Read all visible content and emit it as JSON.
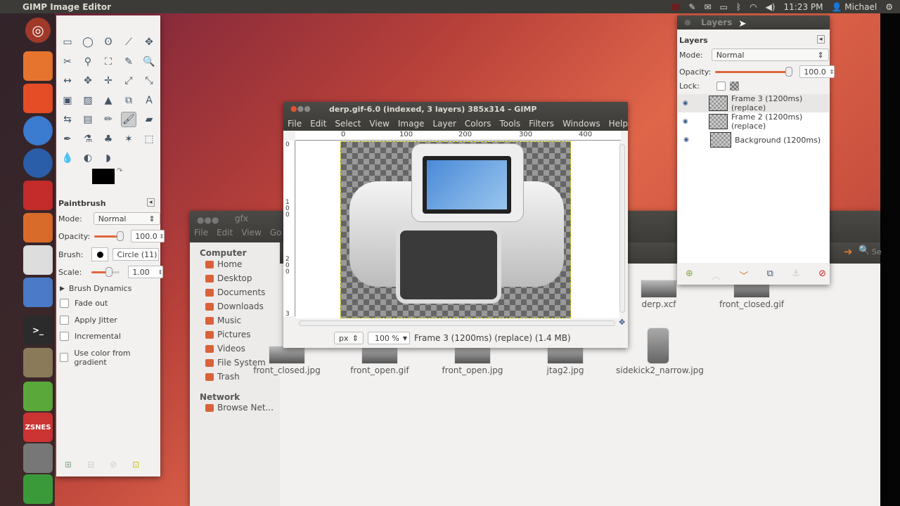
{
  "top_panel": {
    "app_title": "GIMP Image Editor",
    "time": "11:23 PM",
    "user": "Michael",
    "indicators": [
      "network-status-icon",
      "paperclip-icon",
      "mail-icon",
      "battery-icon",
      "bluetooth-icon",
      "wifi-icon",
      "volume-icon"
    ]
  },
  "launcher": {
    "items": [
      "ubuntu-dash",
      "files",
      "firefox-alt",
      "chromium",
      "thunderbird",
      "pdf-reader",
      "inkscape",
      "text-editor",
      "pidgin",
      "terminal",
      "gimp",
      "system-settings",
      "zsnes",
      "keyboard-app",
      "spreadsheet"
    ]
  },
  "toolbox": {
    "options_title": "Paintbrush",
    "mode_label": "Mode:",
    "mode_value": "Normal",
    "opacity_label": "Opacity:",
    "opacity_value": "100.0",
    "opacity_fraction": 1.0,
    "brush_label": "Brush:",
    "brush_value": "Circle (11)",
    "scale_label": "Scale:",
    "scale_value": "1.00",
    "brush_dynamics": "Brush Dynamics",
    "checkboxes": [
      {
        "label": "Fade out",
        "checked": false
      },
      {
        "label": "Apply Jitter",
        "checked": false
      },
      {
        "label": "Incremental",
        "checked": false
      },
      {
        "label": "Use color from gradient",
        "checked": false
      }
    ],
    "foreground": "#000000",
    "background": "#ffffff"
  },
  "image_window": {
    "title": "derp.gif-6.0 (indexed, 3 layers) 385x314 – GIMP",
    "menu": [
      "File",
      "Edit",
      "Select",
      "View",
      "Image",
      "Layer",
      "Colors",
      "Tools",
      "Filters",
      "Windows",
      "Help"
    ],
    "ruler_ticks": [
      "0",
      "100",
      "200",
      "300",
      "400"
    ],
    "vruler_ticks": [
      "0",
      "1 0 0",
      "2 0 0",
      "3"
    ],
    "unit": "px",
    "zoom": "100 %",
    "status": "Frame 3 (1200ms) (replace) (1.4 MB)"
  },
  "layers_window": {
    "window_title": "Layers",
    "panel_title": "Layers",
    "mode_label": "Mode:",
    "mode_value": "Normal",
    "opacity_label": "Opacity:",
    "opacity_value": "100.0",
    "lock_label": "Lock:",
    "layers": [
      {
        "name": "Frame 3 (1200ms) (replace)",
        "selected": true
      },
      {
        "name": "Frame 2 (1200ms) (replace)",
        "selected": false
      },
      {
        "name": "Background (1200ms)",
        "selected": false
      }
    ]
  },
  "file_manager": {
    "title": "gfx",
    "menu": [
      "File",
      "Edit",
      "View",
      "Go"
    ],
    "search_label": "Se",
    "computer_heading": "Computer",
    "places": [
      "Home",
      "Desktop",
      "Documents",
      "Downloads",
      "Music",
      "Pictures",
      "Videos",
      "File System",
      "Trash"
    ],
    "network_heading": "Network",
    "network_items": [
      "Browse Net..."
    ],
    "files": [
      "derp.xcf",
      "front_closed.gif",
      "front_closed.jpg",
      "front_open.gif",
      "front_open.jpg",
      "jtag2.jpg",
      "sidekick2_narrow.jpg"
    ]
  },
  "colors": {
    "accent": "#e0663c",
    "panel": "#3c3b37",
    "window_bg": "#f2f1f0"
  }
}
